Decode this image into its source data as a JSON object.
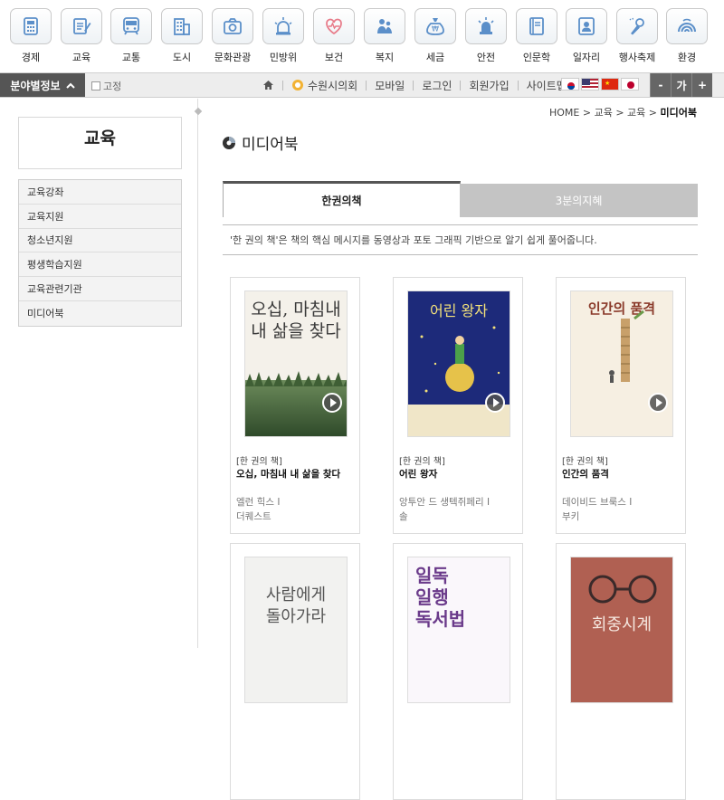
{
  "categories": [
    {
      "label": "경제",
      "icon": "calculator-icon",
      "color": "#5b8fc9"
    },
    {
      "label": "교육",
      "icon": "notebook-pen-icon",
      "color": "#5b8fc9"
    },
    {
      "label": "교통",
      "icon": "subway-icon",
      "color": "#5b8fc9"
    },
    {
      "label": "도시",
      "icon": "building-icon",
      "color": "#5b8fc9"
    },
    {
      "label": "문화관광",
      "icon": "camera-icon",
      "color": "#5b8fc9"
    },
    {
      "label": "민방위",
      "icon": "siren-icon",
      "color": "#5b8fc9"
    },
    {
      "label": "보건",
      "icon": "heart-pulse-icon",
      "color": "#e87c8a"
    },
    {
      "label": "복지",
      "icon": "people-icon",
      "color": "#5b8fc9"
    },
    {
      "label": "세금",
      "icon": "money-bag-icon",
      "color": "#5b8fc9"
    },
    {
      "label": "안전",
      "icon": "alarm-light-icon",
      "color": "#5b8fc9"
    },
    {
      "label": "인문학",
      "icon": "book-icon",
      "color": "#5b8fc9"
    },
    {
      "label": "일자리",
      "icon": "id-card-icon",
      "color": "#5b8fc9"
    },
    {
      "label": "행사축제",
      "icon": "microphone-icon",
      "color": "#5b8fc9"
    },
    {
      "label": "환경",
      "icon": "rainbow-icon",
      "color": "#5b8fc9"
    }
  ],
  "utility": {
    "field_button": "분야별정보",
    "fix_label": "고정",
    "links": [
      "수원시의회",
      "모바일",
      "로그인",
      "회원가입",
      "사이트맵"
    ],
    "flags": [
      "korea-flag-icon",
      "usa-flag-icon",
      "china-flag-icon",
      "japan-flag-icon"
    ],
    "font_minus": "-",
    "font_label": "가",
    "font_plus": "+"
  },
  "sidebar": {
    "title": "교육",
    "items": [
      "교육강좌",
      "교육지원",
      "청소년지원",
      "평생학습지원",
      "교육관련기관",
      "미디어북"
    ]
  },
  "breadcrumb": {
    "items": [
      "HOME",
      "교육",
      "교육"
    ],
    "current": "미디어북"
  },
  "page_title": "미디어북",
  "tabs": [
    {
      "label": "한권의책",
      "active": true
    },
    {
      "label": "3분의지혜",
      "active": false
    }
  ],
  "description": "'한 권의 책'은 책의 핵심 메시지를 동영상과 포토 그래픽 기반으로 알기 쉽게 풀어줍니다.",
  "books": [
    {
      "category": "[한 권의 책]",
      "title": "오십, 마침내 내 삶을 찾다",
      "author": "엘런 힉스 I",
      "publisher": "더퀘스트",
      "cover": "오십, 마침내\n내 삶을 찾다"
    },
    {
      "category": "[한 권의 책]",
      "title": "어린 왕자",
      "author": "앙투안 드 생텍쥐페리 I",
      "publisher": "솔",
      "cover": "어린 왕자"
    },
    {
      "category": "[한 권의 책]",
      "title": "인간의 품격",
      "author": "데이비드 브룩스 I",
      "publisher": "부키",
      "cover": "인간의 품격"
    },
    {
      "cover": "사람에게\n돌아가라"
    },
    {
      "cover": "일독\n일행\n독서법"
    },
    {
      "cover": "회중시계"
    }
  ]
}
